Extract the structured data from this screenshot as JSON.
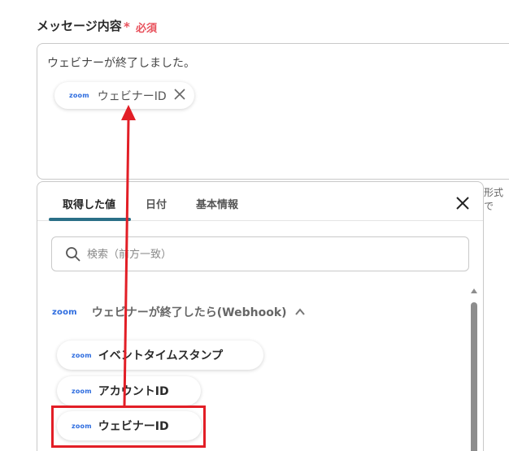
{
  "field": {
    "label": "メッセージ内容",
    "required_star": "*",
    "required_text": "必須"
  },
  "editor": {
    "text": "ウェビナーが終了しました。",
    "chip": {
      "logo": "zoom",
      "label": "ウェビナーID"
    }
  },
  "side_hint": "形式で",
  "panel": {
    "tabs": [
      {
        "label": "取得した値",
        "active": true
      },
      {
        "label": "日付",
        "active": false
      },
      {
        "label": "基本情報",
        "active": false
      }
    ],
    "search_placeholder": "検索（前方一致）",
    "group": {
      "logo": "zoom",
      "title": "ウェビナーが終了したら(Webhook)"
    },
    "items": [
      {
        "logo": "zoom",
        "label": "イベントタイムスタンプ"
      },
      {
        "logo": "zoom",
        "label": "アカウントID"
      },
      {
        "logo": "zoom",
        "label": "ウェビナーID"
      }
    ]
  },
  "colors": {
    "required": "#e8505b",
    "tab_underline": "#2a6f87",
    "zoom_brand": "#2d6cdf",
    "annotation": "#e21e26"
  },
  "icons": [
    "close-icon",
    "search-icon",
    "chevron-up-icon",
    "scroll-up-arrow-icon"
  ]
}
